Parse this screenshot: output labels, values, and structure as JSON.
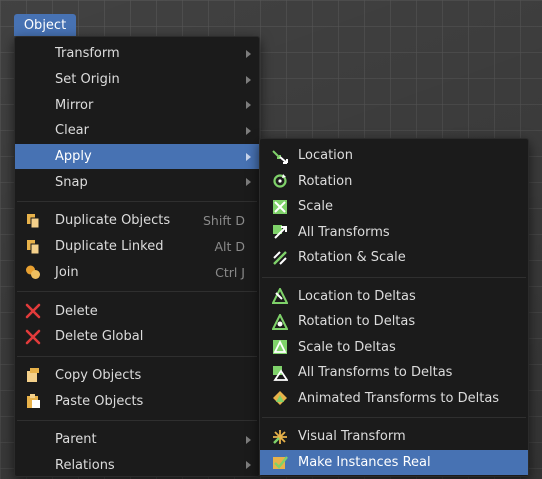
{
  "menubar": {
    "object_label": "Object"
  },
  "main_menu": {
    "items": [
      {
        "label": "Transform"
      },
      {
        "label": "Set Origin"
      },
      {
        "label": "Mirror"
      },
      {
        "label": "Clear"
      },
      {
        "label": "Apply"
      },
      {
        "label": "Snap"
      },
      {
        "label": "Duplicate Objects",
        "shortcut": "Shift D"
      },
      {
        "label": "Duplicate Linked",
        "shortcut": "Alt D"
      },
      {
        "label": "Join",
        "shortcut": "Ctrl J"
      },
      {
        "label": "Delete"
      },
      {
        "label": "Delete Global"
      },
      {
        "label": "Copy Objects"
      },
      {
        "label": "Paste Objects"
      },
      {
        "label": "Parent"
      },
      {
        "label": "Relations"
      }
    ]
  },
  "apply_menu": {
    "items": [
      {
        "label": "Location"
      },
      {
        "label": "Rotation"
      },
      {
        "label": "Scale"
      },
      {
        "label": "All Transforms"
      },
      {
        "label": "Rotation & Scale"
      },
      {
        "label": "Location to Deltas"
      },
      {
        "label": "Rotation to Deltas"
      },
      {
        "label": "Scale to Deltas"
      },
      {
        "label": "All Transforms to Deltas"
      },
      {
        "label": "Animated Transforms to Deltas"
      },
      {
        "label": "Visual Transform"
      },
      {
        "label": "Make Instances Real"
      }
    ]
  },
  "colors": {
    "highlight": "#4772b3",
    "menu_bg": "#1b1b1b",
    "text": "#dcdcdc",
    "shortcut_text": "#8a8a8a"
  }
}
